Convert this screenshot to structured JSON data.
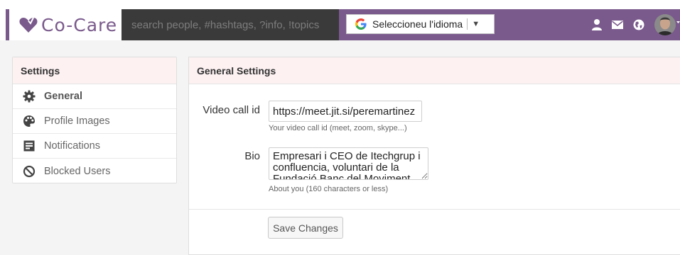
{
  "header": {
    "logo_text": "Co-Care",
    "search_placeholder": "search people, #hashtags, ?info, !topics",
    "translate_label": "Seleccioneu l'idioma",
    "translate_caret": "▼"
  },
  "sidebar": {
    "title": "Settings",
    "items": [
      {
        "label": "General",
        "icon": "gear-icon",
        "active": true
      },
      {
        "label": "Profile Images",
        "icon": "palette-icon"
      },
      {
        "label": "Notifications",
        "icon": "notes-icon"
      },
      {
        "label": "Blocked Users",
        "icon": "block-icon"
      }
    ]
  },
  "main": {
    "title": "General Settings",
    "video": {
      "label": "Video call id",
      "value": "https://meet.jit.si/peremartinez",
      "help": "Your video call id (meet, zoom, skype...)"
    },
    "bio": {
      "label": "Bio",
      "value": "Empresari i CEO de Itechgrup i confluencia, voluntari de la Fundació Banc del Moviment",
      "help": "About you (160 characters or less)"
    },
    "save_label": "Save Changes"
  },
  "colors": {
    "brand": "#7a5a8c",
    "search_bg": "#3a3a3a",
    "panel_header": "#fdf1f2"
  }
}
